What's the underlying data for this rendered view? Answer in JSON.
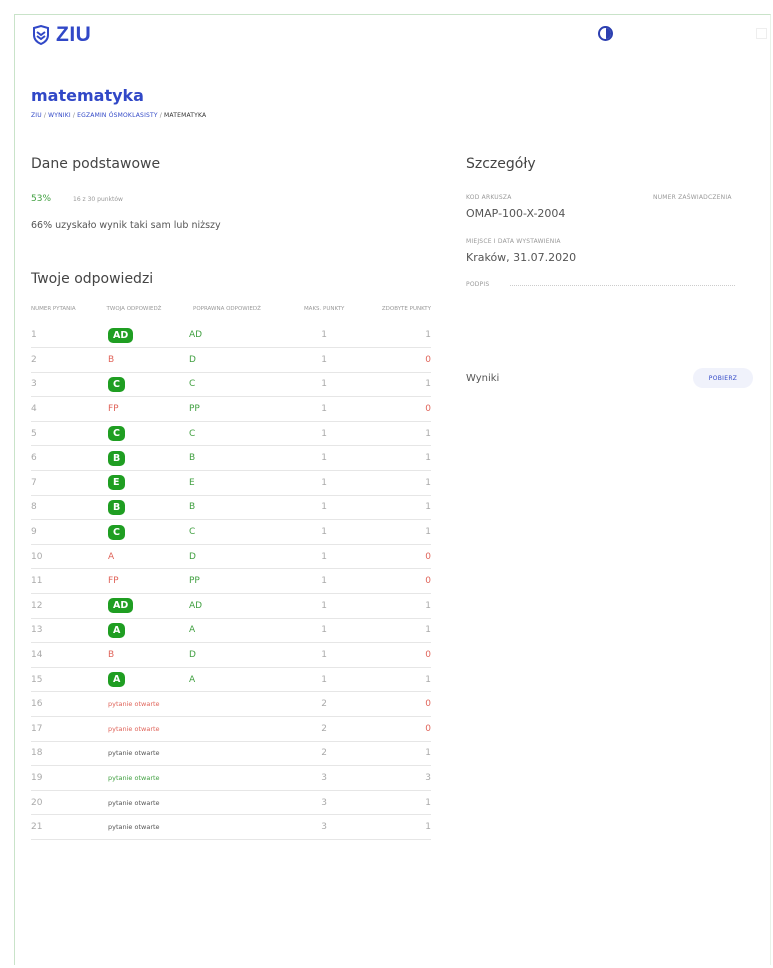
{
  "app": {
    "logo_text": "ZIU"
  },
  "page": {
    "title": "matematyka"
  },
  "breadcrumb": [
    "ziu",
    "wyniki",
    "egzamin ósmoklasisty"
  ],
  "breadcrumb_current": "matematyka",
  "basic": {
    "heading": "Dane podstawowe",
    "percent": "53%",
    "points": "16 z 30 punktów",
    "comparison": "66% uzyskało wynik taki sam lub niższy"
  },
  "answers": {
    "heading": "Twoje odpowiedzi",
    "columns": [
      "numer pytania",
      "twoja odpowiedź",
      "poprawna odpowiedź",
      "maks. punkty",
      "zdobyte punkty"
    ],
    "rows": [
      {
        "num": "1",
        "your": "AD",
        "correct": "AD",
        "max": "1",
        "got": "1",
        "status": "correct"
      },
      {
        "num": "2",
        "your": "B",
        "correct": "D",
        "max": "1",
        "got": "0",
        "status": "wrong"
      },
      {
        "num": "3",
        "your": "C",
        "correct": "C",
        "max": "1",
        "got": "1",
        "status": "correct"
      },
      {
        "num": "4",
        "your": "FP",
        "correct": "PP",
        "max": "1",
        "got": "0",
        "status": "wrong"
      },
      {
        "num": "5",
        "your": "C",
        "correct": "C",
        "max": "1",
        "got": "1",
        "status": "correct"
      },
      {
        "num": "6",
        "your": "B",
        "correct": "B",
        "max": "1",
        "got": "1",
        "status": "correct"
      },
      {
        "num": "7",
        "your": "E",
        "correct": "E",
        "max": "1",
        "got": "1",
        "status": "correct"
      },
      {
        "num": "8",
        "your": "B",
        "correct": "B",
        "max": "1",
        "got": "1",
        "status": "correct"
      },
      {
        "num": "9",
        "your": "C",
        "correct": "C",
        "max": "1",
        "got": "1",
        "status": "correct"
      },
      {
        "num": "10",
        "your": "A",
        "correct": "D",
        "max": "1",
        "got": "0",
        "status": "wrong"
      },
      {
        "num": "11",
        "your": "FP",
        "correct": "PP",
        "max": "1",
        "got": "0",
        "status": "wrong"
      },
      {
        "num": "12",
        "your": "AD",
        "correct": "AD",
        "max": "1",
        "got": "1",
        "status": "correct"
      },
      {
        "num": "13",
        "your": "A",
        "correct": "A",
        "max": "1",
        "got": "1",
        "status": "correct"
      },
      {
        "num": "14",
        "your": "B",
        "correct": "D",
        "max": "1",
        "got": "0",
        "status": "wrong"
      },
      {
        "num": "15",
        "your": "A",
        "correct": "A",
        "max": "1",
        "got": "1",
        "status": "correct"
      },
      {
        "num": "16",
        "your": "pytanie otwarte",
        "correct": "",
        "max": "2",
        "got": "0",
        "status": "open-wrong"
      },
      {
        "num": "17",
        "your": "pytanie otwarte",
        "correct": "",
        "max": "2",
        "got": "0",
        "status": "open-wrong"
      },
      {
        "num": "18",
        "your": "pytanie otwarte",
        "correct": "",
        "max": "2",
        "got": "1",
        "status": "open-partial"
      },
      {
        "num": "19",
        "your": "pytanie otwarte",
        "correct": "",
        "max": "3",
        "got": "3",
        "status": "open-correct"
      },
      {
        "num": "20",
        "your": "pytanie otwarte",
        "correct": "",
        "max": "3",
        "got": "1",
        "status": "open-partial"
      },
      {
        "num": "21",
        "your": "pytanie otwarte",
        "correct": "",
        "max": "3",
        "got": "1",
        "status": "open-partial"
      }
    ]
  },
  "details": {
    "heading": "Szczegóły",
    "kod_label": "kod arkusza",
    "kod_value": "OMAP-100-X-2004",
    "numer_label": "numer zaświadczenia",
    "miejsce_label": "miejsce i data wystawienia",
    "miejsce_value": "Kraków, 31.07.2020",
    "podpis_label": "podpis"
  },
  "results": {
    "label": "Wyniki",
    "button": "pobierz"
  },
  "colors": {
    "accent": "#3148c7",
    "correct": "#41a041",
    "wrong": "#e0645a",
    "badge": "#1f9e22"
  }
}
